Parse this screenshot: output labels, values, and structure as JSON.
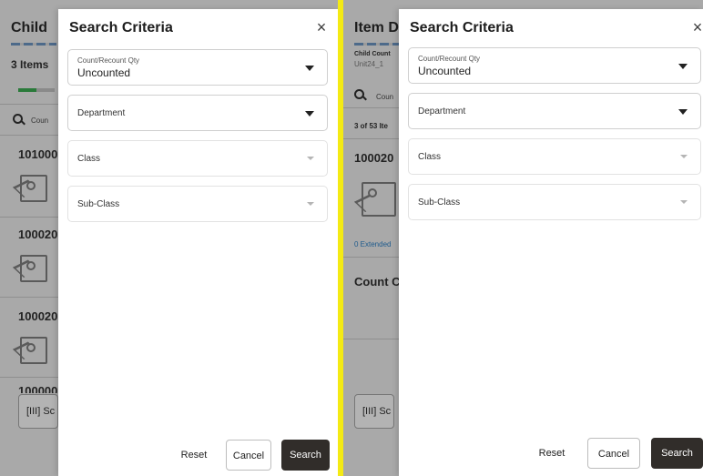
{
  "colors": {
    "divider": "#f4ea14",
    "primary_button": "#312d2a",
    "overlay": "#a9a9a9"
  },
  "left": {
    "background": {
      "header_title": "Child",
      "items_count": "3 Items",
      "progress_value": 0.5,
      "search_placeholder": "Coun",
      "item_ids": [
        "101000",
        "100020",
        "100020",
        "100000"
      ],
      "scan_button_label": "Sc"
    },
    "modal": {
      "title": "Search Criteria",
      "close_label": "×",
      "count_field": {
        "label": "Count/Recount Qty",
        "value": "Uncounted"
      },
      "department_label": "Department",
      "class_label": "Class",
      "subclass_label": "Sub-Class",
      "reset_label": "Reset",
      "cancel_label": "Cancel",
      "search_label": "Search"
    }
  },
  "right": {
    "background": {
      "header_title": "Item D",
      "child_count_label": "Child Count",
      "child_count_value": "Unit24_1",
      "search_placeholder": "Coun",
      "items_count": "3 of 53 Ite",
      "item_id": "100020",
      "extended_link": "0 Extended",
      "section_title": "Count C",
      "scan_button_label": "Sc"
    },
    "modal": {
      "title": "Search Criteria",
      "close_label": "×",
      "count_field": {
        "label": "Count/Recount Qty",
        "value": "Uncounted"
      },
      "department_label": "Department",
      "class_label": "Class",
      "subclass_label": "Sub-Class",
      "reset_label": "Reset",
      "cancel_label": "Cancel",
      "search_label": "Search"
    }
  }
}
